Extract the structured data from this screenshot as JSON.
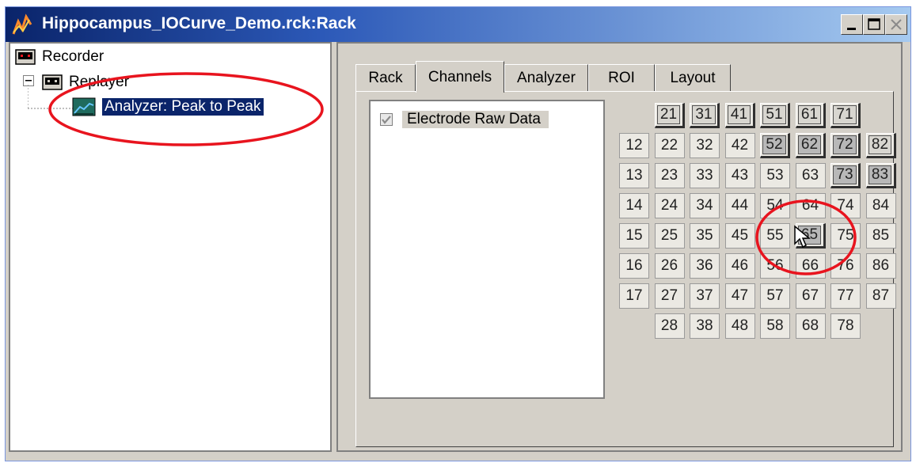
{
  "window": {
    "title": "Hippocampus_IOCurve_Demo.rck:Rack",
    "controls": [
      "minimize",
      "maximize",
      "close"
    ]
  },
  "tree": {
    "recorder": "Recorder",
    "replayer": "Replayer",
    "analyzer": "Analyzer: Peak to Peak"
  },
  "tabs": [
    "Rack",
    "Channels",
    "Analyzer",
    "ROI",
    "Layout"
  ],
  "active_tab": "Channels",
  "streams": [
    {
      "label": "Electrode Raw Data",
      "checked": true
    }
  ],
  "electrode_grid": {
    "rows": [
      [
        "",
        "21",
        "31",
        "41",
        "51",
        "61",
        "71",
        ""
      ],
      [
        "12",
        "22",
        "32",
        "42",
        "52",
        "62",
        "72",
        "82"
      ],
      [
        "13",
        "23",
        "33",
        "43",
        "53",
        "63",
        "73",
        "83"
      ],
      [
        "14",
        "24",
        "34",
        "44",
        "54",
        "64",
        "74",
        "84"
      ],
      [
        "15",
        "25",
        "35",
        "45",
        "55",
        "65",
        "75",
        "85"
      ],
      [
        "16",
        "26",
        "36",
        "46",
        "56",
        "66",
        "76",
        "86"
      ],
      [
        "17",
        "27",
        "37",
        "47",
        "57",
        "67",
        "77",
        "87"
      ],
      [
        "",
        "28",
        "38",
        "48",
        "58",
        "68",
        "78",
        ""
      ]
    ],
    "raised": [
      "21",
      "31",
      "41",
      "51",
      "61",
      "71",
      "52",
      "62",
      "72",
      "82",
      "73",
      "83",
      "65"
    ],
    "highlighted": [
      "52",
      "62",
      "72",
      "73",
      "83",
      "65"
    ]
  },
  "colors": {
    "annotation": "#e8141e",
    "title_gradient_start": "#0a246a",
    "selection": "#0a246a"
  }
}
